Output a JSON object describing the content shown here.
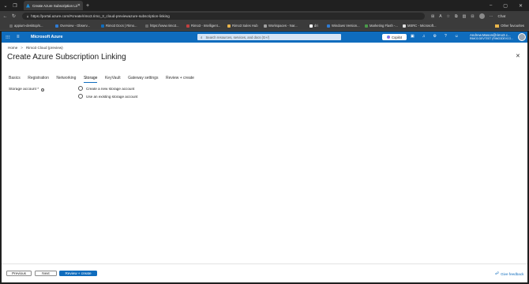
{
  "browser": {
    "tab_title": "Create Azure Subscription Linking",
    "url": "https://portal.azure.com/#create/rimo3.rimo_3_cloud-previewazure-subscription-linking",
    "chat_label": "Chat",
    "bookmarks": [
      {
        "label": "appium-desktop/s...",
        "color": "#6a6a6a"
      },
      {
        "label": "Overview - Observ...",
        "color": "#2f7bd3"
      },
      {
        "label": "Rimo3 Docs | Rimo...",
        "color": "#0f6cbd"
      },
      {
        "label": "https://www.rimo3...",
        "color": "#6a6a6a"
      },
      {
        "label": "Rimo3 - Intelligent...",
        "color": "#c04040"
      },
      {
        "label": "Rimo3 Sales Hub",
        "color": "#e8b44a"
      },
      {
        "label": "Workspaces - Nar...",
        "color": "#a0a0a0"
      },
      {
        "label": "dri",
        "color": "#ffffff"
      },
      {
        "label": "Windows Version...",
        "color": "#2f7bd3"
      },
      {
        "label": "Marketing Flash -...",
        "color": "#4a9a4a"
      },
      {
        "label": "MSRC - Microsoft...",
        "color": "#e0e0e0"
      }
    ],
    "other_favorites": "Other favourites"
  },
  "portal": {
    "brand": "Microsoft Azure",
    "search_placeholder": "Search resources, services, and docs (G+/)",
    "copilot_label": "Copilot",
    "user_name": "Andrew.Mason@rimo3.c...",
    "user_directory": "RIMO3 DEVTEST (RIMO3DEVCO..."
  },
  "breadcrumb": {
    "home": "Home",
    "sep": ">",
    "item": "Rimo3 Cloud (preview)"
  },
  "page": {
    "title": "Create Azure Subscription Linking",
    "more": "···",
    "close": "✕"
  },
  "tabs": [
    {
      "label": "Basics",
      "active": false
    },
    {
      "label": "Registration",
      "active": false
    },
    {
      "label": "Networking",
      "active": false
    },
    {
      "label": "Storage",
      "active": true
    },
    {
      "label": "KeyVault",
      "active": false
    },
    {
      "label": "Gateway settings",
      "active": false
    },
    {
      "label": "Review + create",
      "active": false
    }
  ],
  "storage": {
    "label": "Storage account *",
    "options": [
      {
        "label": "Create a new storage account",
        "selected": false
      },
      {
        "label": "Use an existing storage account",
        "selected": false
      }
    ]
  },
  "footer": {
    "previous": "Previous",
    "next": "Next",
    "review": "Review + create",
    "feedback": "Give feedback"
  }
}
